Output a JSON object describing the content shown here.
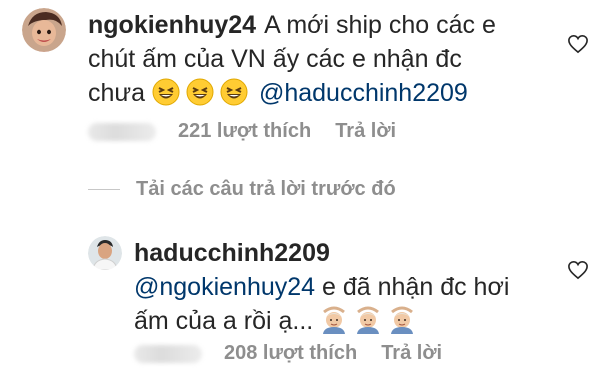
{
  "comments": [
    {
      "username": "ngokienhuy24",
      "text": "A mới ship cho các e chút ấm của VN ấy các e nhận đc chưa",
      "emojis": [
        "grinning-squinting-face",
        "grinning-squinting-face",
        "grinning-squinting-face"
      ],
      "mention": "@haducchinh2209",
      "likes": "221 lượt thích",
      "reply_label": "Trả lời"
    },
    {
      "username": "haducchinh2209",
      "mention": "@ngokienhuy24",
      "text": "e đã nhận đc hơi ấm của a rồi ạ...",
      "emojis": [
        "person-gesturing-ok",
        "person-gesturing-ok",
        "person-gesturing-ok"
      ],
      "likes": "208 lượt thích",
      "reply_label": "Trả lời"
    }
  ],
  "load_more_label": "Tải các câu trả lời trước đó",
  "colors": {
    "text": "#262626",
    "muted": "#8e8e8e",
    "mention": "#00376b"
  },
  "icons": {
    "like": "heart-outline-icon"
  }
}
